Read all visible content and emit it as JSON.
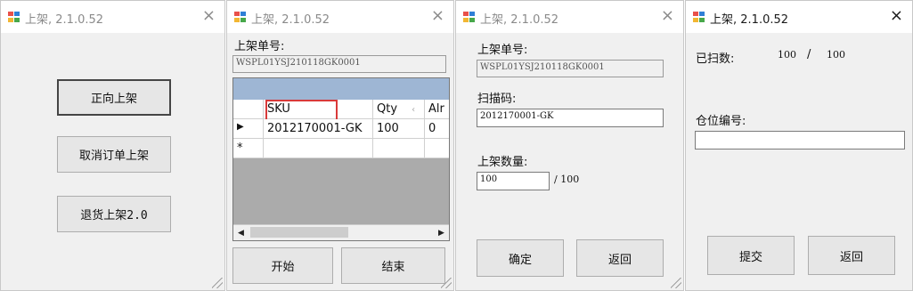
{
  "colors": {
    "icon_red": "#e8504a",
    "icon_blue": "#2f7fd6",
    "icon_yellow": "#f2b632",
    "icon_green": "#47a84a",
    "highlight": "#d93a3a",
    "grid_caption": "#9eb6d4"
  },
  "windows": [
    {
      "title": "上架, 2.1.0.52",
      "close": "×",
      "icon": "app-grid-icon",
      "buttons": [
        "正向上架",
        "取消订单上架",
        "退货上架2.0"
      ]
    },
    {
      "title": "上架, 2.1.0.52",
      "close": "×",
      "icon": "app-grid-icon",
      "order_label": "上架单号:",
      "order_value": "WSPL01YSJ210118GK0001",
      "grid": {
        "columns": [
          "SKU",
          "Qty",
          "Alr"
        ],
        "sort_glyph": "‹",
        "rows": [
          {
            "marker": "▶",
            "sku": "2012170001-GK",
            "qty": "100",
            "alr": "0"
          }
        ],
        "new_row_marker": "*",
        "scroll_left": "◀",
        "scroll_right": "▶"
      },
      "start_label": "开始",
      "end_label": "结束"
    },
    {
      "title": "上架, 2.1.0.52",
      "close": "×",
      "icon": "app-grid-icon",
      "order_label": "上架单号:",
      "order_value": "WSPL01YSJ210118GK0001",
      "scan_label": "扫描码:",
      "scan_value": "2012170001-GK",
      "qty_label": "上架数量:",
      "qty_value": "100",
      "qty_total": "/ 100",
      "confirm_label": "确定",
      "back_label": "返回"
    },
    {
      "title": "上架, 2.1.0.52",
      "close": "×",
      "icon": "app-grid-icon",
      "scanned_label": "已扫数:",
      "scanned_value": "100",
      "scanned_sep": "/",
      "scanned_total": "100",
      "location_label": "仓位编号:",
      "location_value": "",
      "submit_label": "提交",
      "back_label": "返回"
    }
  ]
}
